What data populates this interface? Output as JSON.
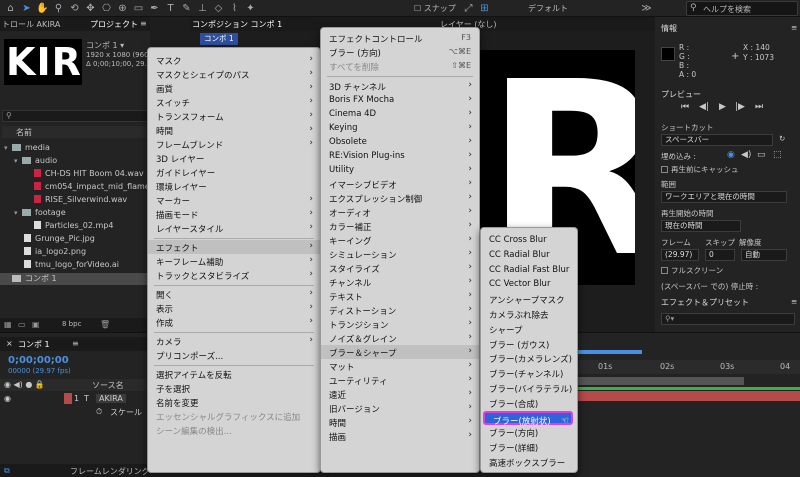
{
  "toolbar": {
    "snap_label": "スナップ",
    "workspace": "デフォルト",
    "help_placeholder": "ヘルプを検索"
  },
  "project_panel": {
    "tab_control": "トロール AKIRA",
    "tab_project": "プロジェクト",
    "thumb_text": "KIR",
    "comp_name": "コンポ 1 ▾",
    "resolution": "1920 x 1080 (960",
    "duration": "Δ 0;00;10;00, 29.97",
    "column_name": "名前",
    "bpc": "8 bpc",
    "items": [
      {
        "label": "media",
        "type": "folder",
        "indent": 0
      },
      {
        "label": "audio",
        "type": "folder",
        "indent": 1
      },
      {
        "label": "CH-DS HIT Boom 04.wav",
        "type": "audio",
        "indent": 2
      },
      {
        "label": "cm054_impact_mid_flame",
        "type": "audio",
        "indent": 2
      },
      {
        "label": "RISE_Silverwind.wav",
        "type": "audio",
        "indent": 2
      },
      {
        "label": "footage",
        "type": "folder",
        "indent": 1
      },
      {
        "label": "Particles_02.mp4",
        "type": "file",
        "indent": 2
      },
      {
        "label": "Grunge_Pic.jpg",
        "type": "file",
        "indent": 1
      },
      {
        "label": "ia_logo2.png",
        "type": "file",
        "indent": 1
      },
      {
        "label": "tmu_logo_forVideo.ai",
        "type": "file",
        "indent": 1
      },
      {
        "label": "コンポ 1",
        "type": "comp",
        "indent": 0
      }
    ]
  },
  "viewer": {
    "tab_label": "コンポジション コンポ 1",
    "comp_tab": "コンポ 1",
    "layer_label": "レイヤー (なし)",
    "canvas_letter": "R"
  },
  "info_panel": {
    "title": "情報",
    "r": "R :",
    "g": "G :",
    "b": "B :",
    "a": "A : 0",
    "x": "X : 140",
    "y": "Y : 1073",
    "preview_title": "プレビュー",
    "shortcut_label": "ショートカット",
    "shortcut_value": "スペースバー",
    "embed_label": "埋め込み :",
    "cache_label": "再生前にキャッシュ",
    "range_label": "範囲",
    "range_value": "ワークエリアと現在の時間",
    "start_label": "再生開始の時間",
    "start_value": "現在の時間",
    "frame_label": "フレーム",
    "skip_label": "スキップ",
    "res_label": "解像度",
    "fps_value": "(29.97)",
    "skip_value": "0",
    "res_value": "自動",
    "fullscreen_label": "フルスクリーン",
    "stop_label": "(スペースバー での) 停止時 :",
    "effects_title": "エフェクト＆プリセット"
  },
  "timeline": {
    "tab_label": "コンポ 1",
    "timecode": "0;00;00;00",
    "fps": "00000 (29.97 fps)",
    "source_col": "ソース名",
    "layer_num": "1",
    "layer_name": "AKIRA",
    "scale_label": "スケール",
    "footer_label": "フレームレンダリング",
    "ticks": [
      "01s",
      "02s",
      "03s",
      "04"
    ]
  },
  "menu_main": [
    {
      "label": "マスク",
      "arrow": true
    },
    {
      "label": "マスクとシェイプのパス",
      "arrow": true
    },
    {
      "label": "画質",
      "arrow": true
    },
    {
      "label": "スイッチ",
      "arrow": true
    },
    {
      "label": "トランスフォーム",
      "arrow": true
    },
    {
      "label": "時間",
      "arrow": true
    },
    {
      "label": "フレームブレンド",
      "arrow": true
    },
    {
      "label": "3D レイヤー",
      "arrow": false
    },
    {
      "label": "ガイドレイヤー",
      "arrow": false
    },
    {
      "label": "環境レイヤー",
      "arrow": false
    },
    {
      "label": "マーカー",
      "arrow": true
    },
    {
      "label": "描画モード",
      "arrow": true
    },
    {
      "label": "レイヤースタイル",
      "arrow": true
    },
    {
      "sep": true
    },
    {
      "label": "エフェクト",
      "arrow": true,
      "active": true
    },
    {
      "label": "キーフレーム補助",
      "arrow": true
    },
    {
      "label": "トラックとスタビライズ",
      "arrow": true
    },
    {
      "sep": true
    },
    {
      "label": "開く",
      "arrow": true
    },
    {
      "label": "表示",
      "arrow": true
    },
    {
      "label": "作成",
      "arrow": true
    },
    {
      "sep": true
    },
    {
      "label": "カメラ",
      "arrow": true
    },
    {
      "label": "プリコンポーズ...",
      "arrow": false
    },
    {
      "sep": true
    },
    {
      "label": "選択アイテムを反転",
      "arrow": false
    },
    {
      "label": "子を選択",
      "arrow": false
    },
    {
      "label": "名前を変更",
      "arrow": false
    },
    {
      "label": "エッセンシャルグラフィックスに追加",
      "arrow": false,
      "disabled": true
    },
    {
      "label": "シーン編集の検出...",
      "arrow": false,
      "disabled": true
    }
  ],
  "menu_effects": [
    {
      "label": "エフェクトコントロール",
      "shortcut": "F3"
    },
    {
      "label": "ブラー (方向)",
      "shortcut": "⌥⌘E"
    },
    {
      "label": "すべてを削除",
      "shortcut": "⇧⌘E",
      "disabled": true
    },
    {
      "sep": true
    },
    {
      "label": "3D チャンネル",
      "arrow": true
    },
    {
      "label": "Boris FX Mocha",
      "arrow": true
    },
    {
      "label": "Cinema 4D",
      "arrow": true
    },
    {
      "label": "Keying",
      "arrow": true
    },
    {
      "label": "Obsolete",
      "arrow": true
    },
    {
      "label": "RE:Vision Plug-ins",
      "arrow": true
    },
    {
      "label": "Utility",
      "arrow": true
    },
    {
      "label": "イマーシブビデオ",
      "arrow": true
    },
    {
      "label": "エクスプレッション制御",
      "arrow": true
    },
    {
      "label": "オーディオ",
      "arrow": true
    },
    {
      "label": "カラー補正",
      "arrow": true
    },
    {
      "label": "キーイング",
      "arrow": true
    },
    {
      "label": "シミュレーション",
      "arrow": true
    },
    {
      "label": "スタイライズ",
      "arrow": true
    },
    {
      "label": "チャンネル",
      "arrow": true
    },
    {
      "label": "テキスト",
      "arrow": true
    },
    {
      "label": "ディストーション",
      "arrow": true
    },
    {
      "label": "トランジション",
      "arrow": true
    },
    {
      "label": "ノイズ＆グレイン",
      "arrow": true
    },
    {
      "label": "ブラー＆シャープ",
      "arrow": true,
      "active": true
    },
    {
      "label": "マット",
      "arrow": true
    },
    {
      "label": "ユーティリティ",
      "arrow": true
    },
    {
      "label": "遠近",
      "arrow": true
    },
    {
      "label": "旧バージョン",
      "arrow": true
    },
    {
      "label": "時間",
      "arrow": true
    },
    {
      "label": "描画",
      "arrow": true
    }
  ],
  "menu_blur": [
    {
      "label": "CC Cross Blur"
    },
    {
      "label": "CC Radial Blur"
    },
    {
      "label": "CC Radial Fast Blur"
    },
    {
      "label": "CC Vector Blur"
    },
    {
      "label": "アンシャープマスク"
    },
    {
      "label": "カメラぶれ除去"
    },
    {
      "label": "シャープ"
    },
    {
      "label": "ブラー (ガウス)"
    },
    {
      "label": "ブラー(カメラレンズ)"
    },
    {
      "label": "ブラー(チャンネル)"
    },
    {
      "label": "ブラー(バイラテラル)"
    },
    {
      "label": "ブラー(合成)"
    },
    {
      "label": "ブラー(放射状)",
      "highlight": true
    },
    {
      "label": "ブラー(方向)"
    },
    {
      "label": "ブラー(詳細)"
    },
    {
      "label": "高速ボックスブラー"
    }
  ],
  "colors": {
    "highlight": "#2f63d8",
    "highlight_border": "#e43be0",
    "timecode": "#4a90e2",
    "work_green": "#3cb043",
    "layer_red": "#b54a4a"
  }
}
